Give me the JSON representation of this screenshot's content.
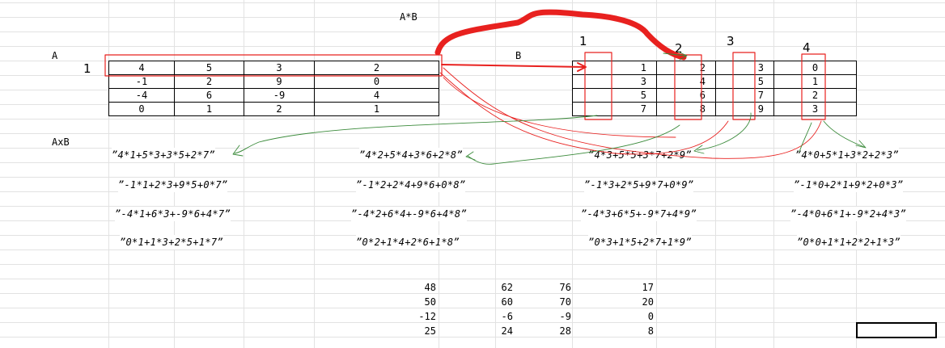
{
  "title": "A*B",
  "labels": {
    "a": "A",
    "b": "B",
    "axb": "AxB",
    "row_marker": "1"
  },
  "column_markers": [
    "1",
    "2",
    "3",
    "4"
  ],
  "matrix_a": [
    [
      "4",
      "5",
      "3",
      "2"
    ],
    [
      "-1",
      "2",
      "9",
      "0"
    ],
    [
      "-4",
      "6",
      "-9",
      "4"
    ],
    [
      "0",
      "1",
      "2",
      "1"
    ]
  ],
  "matrix_b": [
    [
      "1",
      "2",
      "3",
      "0"
    ],
    [
      "3",
      "4",
      "5",
      "1"
    ],
    [
      "5",
      "6",
      "7",
      "2"
    ],
    [
      "7",
      "8",
      "9",
      "3"
    ]
  ],
  "formulas": [
    [
      "”4*1+5*3+3*5+2*7”",
      "”4*2+5*4+3*6+2*8”",
      "”4*3+5*5+3*7+2*9”",
      "”4*0+5*1+3*2+2*3”"
    ],
    [
      "”-1*1+2*3+9*5+0*7”",
      "”-1*2+2*4+9*6+0*8”",
      "”-1*3+2*5+9*7+0*9”",
      "”-1*0+2*1+9*2+0*3”"
    ],
    [
      "”-4*1+6*3+-9*6+4*7”",
      "”-4*2+6*4+-9*6+4*8”",
      "”-4*3+6*5+-9*7+4*9”",
      "”-4*0+6*1+-9*2+4*3”"
    ],
    [
      "”0*1+1*3+2*5+1*7”",
      "”0*2+1*4+2*6+1*8”",
      "”0*3+1*5+2*7+1*9”",
      "”0*0+1*1+2*2+1*3”"
    ]
  ],
  "results": [
    [
      "48",
      "62",
      "76",
      "17"
    ],
    [
      "50",
      "60",
      "70",
      "20"
    ],
    [
      "-12",
      "-6",
      "-9",
      "0"
    ],
    [
      "25",
      "24",
      "28",
      "8"
    ]
  ],
  "colors": {
    "annotation_red": "#e8211f",
    "annotation_green": "#3a8a3a",
    "grid": "#e2e2e2"
  }
}
